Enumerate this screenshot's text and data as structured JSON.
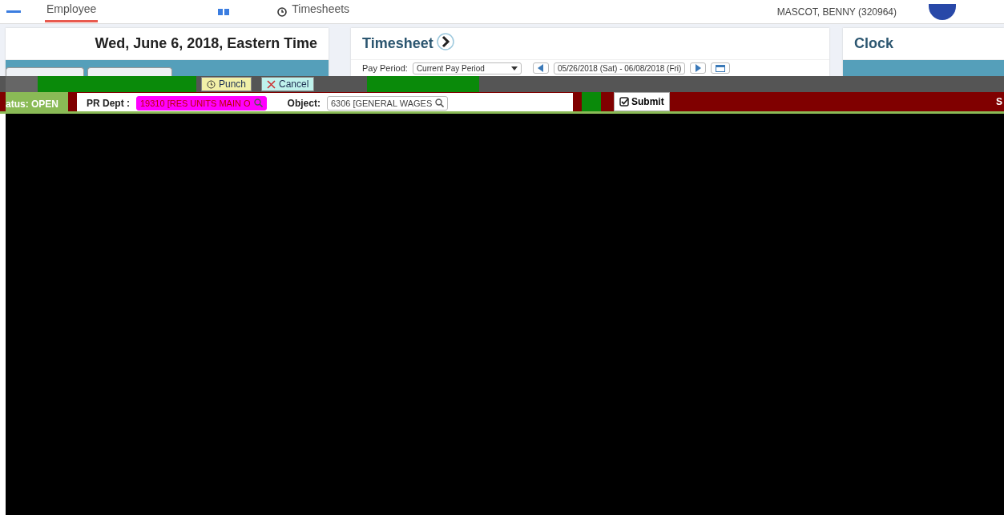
{
  "nav": {
    "tabs": [
      {
        "label": "Employee",
        "selected": true
      },
      {
        "label": "Timesheets",
        "selected": false
      }
    ],
    "user": "MASCOT, BENNY (320964)"
  },
  "date_card": {
    "title": "Wed, June 6, 2018, Eastern Time"
  },
  "timesheet_card": {
    "title": "Timesheet",
    "pay_period_label": "Pay Period:",
    "pay_period": "Current Pay Period",
    "range": "05/26/2018 (Sat) - 06/08/2018 (Fri)"
  },
  "clock_card": {
    "title": "Clock"
  },
  "actions": [
    {
      "label": "Punch",
      "kind": "punch"
    },
    {
      "label": "Cancel",
      "kind": "cancel"
    }
  ],
  "entry": {
    "status": "atus: OPEN",
    "fields": [
      {
        "label": "PR Dept :",
        "value": "19310 [RES UNITS MAIN O",
        "highlighted": true
      },
      {
        "label": "Object:",
        "value": "6306 [GENERAL WAGES",
        "highlighted": false
      }
    ],
    "submit": "Submit",
    "column_3": "S"
  }
}
